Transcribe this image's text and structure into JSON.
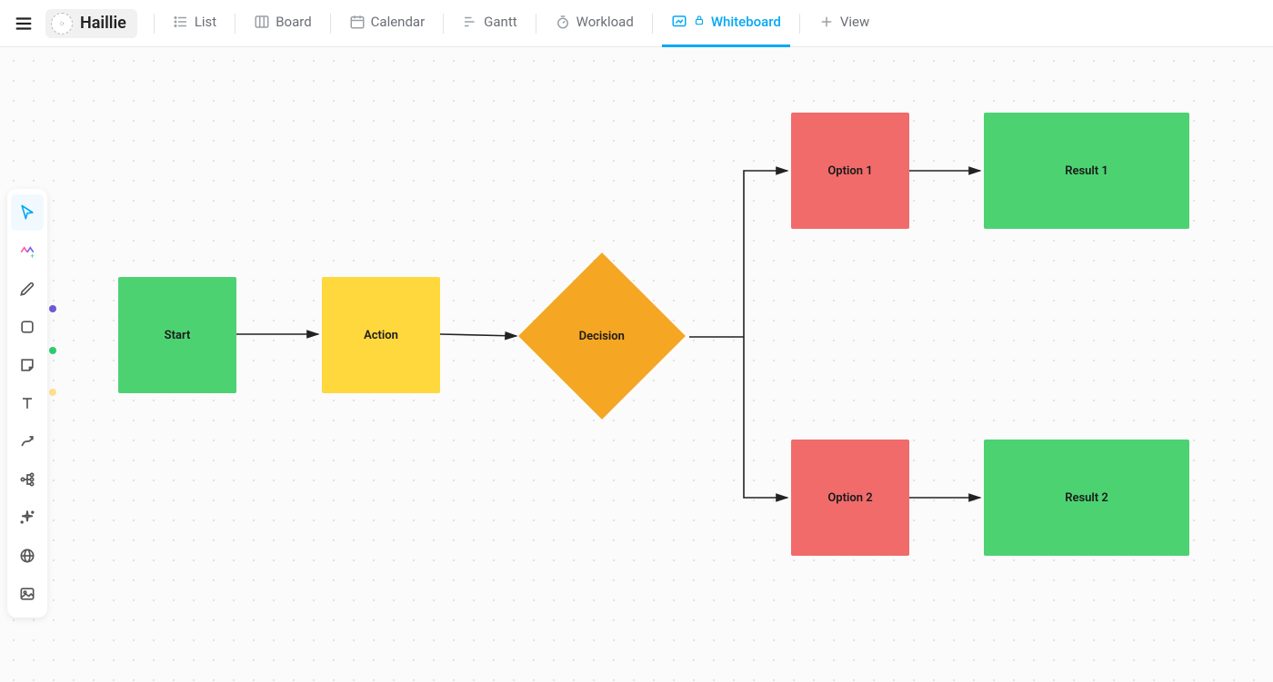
{
  "header": {
    "workspace_name": "Haillie",
    "tabs": {
      "list": "List",
      "board": "Board",
      "calendar": "Calendar",
      "gantt": "Gantt",
      "workload": "Workload",
      "whiteboard": "Whiteboard",
      "add_view": "View"
    }
  },
  "toolbar": {
    "select": "select",
    "ai": "ai",
    "pen": "pen",
    "shape": "shape",
    "sticky": "sticky",
    "text": "text",
    "connector": "connector",
    "mindmap": "mindmap",
    "sparkle": "sparkle",
    "web": "web",
    "image": "image"
  },
  "nodes": {
    "start": "Start",
    "action": "Action",
    "decision": "Decision",
    "option1": "Option 1",
    "option2": "Option 2",
    "result1": "Result 1",
    "result2": "Result 2"
  },
  "colors": {
    "green": "#4dd272",
    "yellow": "#ffd83d",
    "orange": "#f5a623",
    "red": "#f16b6b",
    "accent": "#04a9f4"
  },
  "chart_data": {
    "type": "flowchart",
    "nodes": [
      {
        "id": "start",
        "label": "Start",
        "shape": "rect",
        "color": "green"
      },
      {
        "id": "action",
        "label": "Action",
        "shape": "rect",
        "color": "yellow"
      },
      {
        "id": "decision",
        "label": "Decision",
        "shape": "diamond",
        "color": "orange"
      },
      {
        "id": "option1",
        "label": "Option 1",
        "shape": "rect",
        "color": "red"
      },
      {
        "id": "option2",
        "label": "Option 2",
        "shape": "rect",
        "color": "red"
      },
      {
        "id": "result1",
        "label": "Result 1",
        "shape": "rect",
        "color": "green"
      },
      {
        "id": "result2",
        "label": "Result 2",
        "shape": "rect",
        "color": "green"
      }
    ],
    "edges": [
      {
        "from": "start",
        "to": "action"
      },
      {
        "from": "action",
        "to": "decision"
      },
      {
        "from": "decision",
        "to": "option1"
      },
      {
        "from": "decision",
        "to": "option2"
      },
      {
        "from": "option1",
        "to": "result1"
      },
      {
        "from": "option2",
        "to": "result2"
      }
    ]
  }
}
